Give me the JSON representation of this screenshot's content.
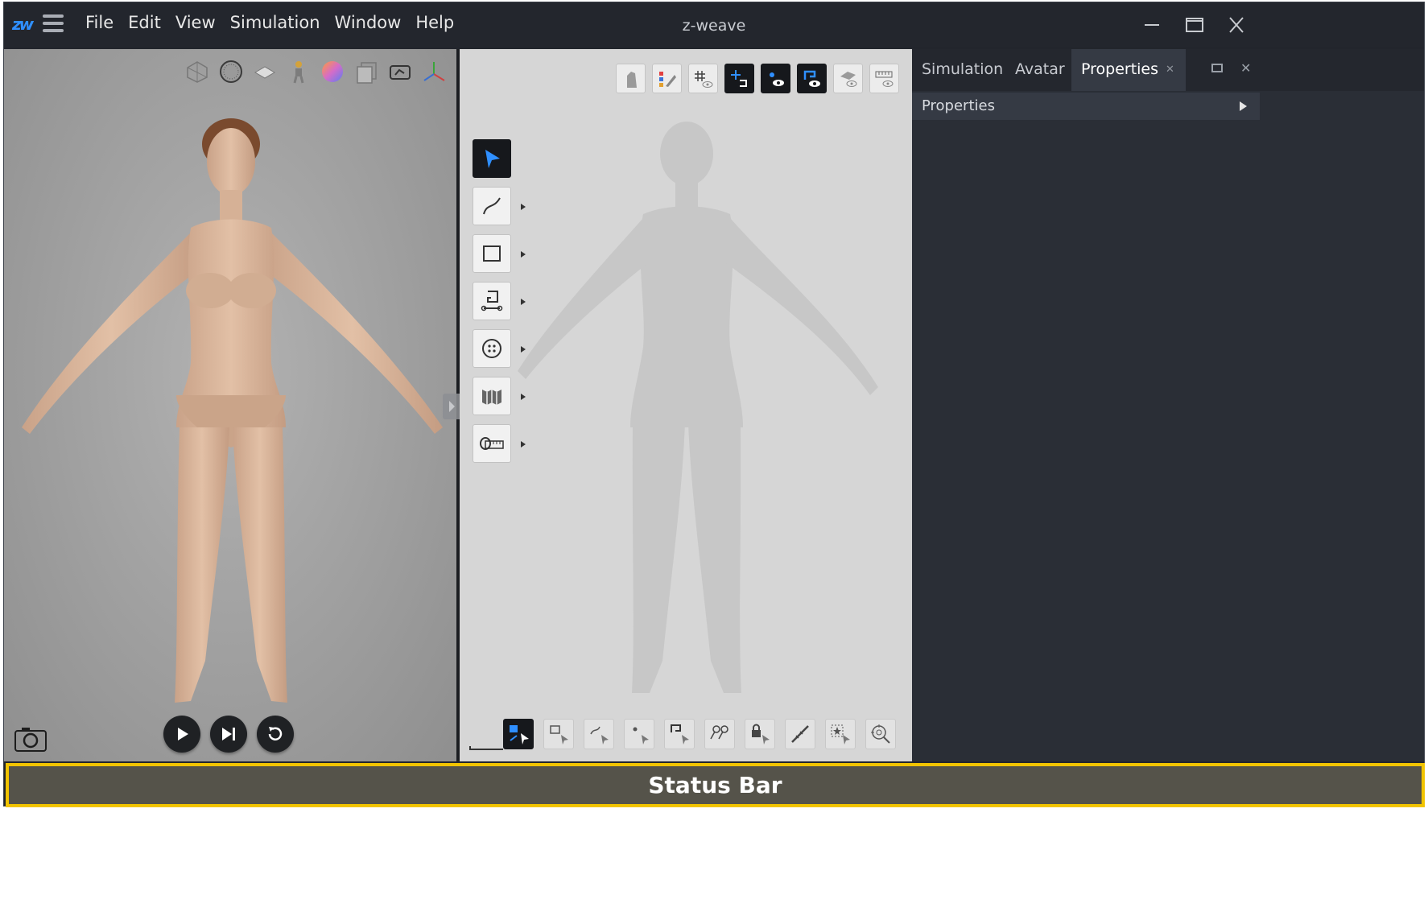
{
  "app": {
    "title": "z-weave",
    "logo_text": "zw"
  },
  "menu": [
    "File",
    "Edit",
    "View",
    "Simulation",
    "Window",
    "Help"
  ],
  "viewport3d": {
    "toolbar_icons": [
      "wireframe-icon",
      "mesh-sphere-icon",
      "plane-icon",
      "avatar-icon",
      "texture-sphere-icon",
      "layer-icon",
      "sewing-icon",
      "gizmo-icon"
    ],
    "playback": [
      "play-icon",
      "step-forward-icon",
      "reset-icon"
    ],
    "camera_icon": "camera-icon"
  },
  "viewport2d": {
    "toolbar_icons": [
      "garment-icon",
      "color-palette-icon",
      "grid-eye-icon",
      "snap-icon",
      "point-eye-icon",
      "sewing-eye-icon",
      "fabric-eye-icon",
      "ruler-eye-icon"
    ],
    "side_tools": [
      "select-arrow-icon",
      "curve-icon",
      "rectangle-icon",
      "sewing-machine-icon",
      "button-icon",
      "fold-icon",
      "tape-measure-icon"
    ],
    "bottom_tools": [
      "edit-pattern-icon",
      "select-box-icon",
      "select-curve-icon",
      "select-point-icon",
      "select-sewing-icon",
      "pin-icon",
      "lock-icon",
      "measure-icon",
      "select-star-icon",
      "search-target-icon"
    ]
  },
  "panel": {
    "tabs": [
      "Simulation",
      "Avatar",
      "Properties"
    ],
    "active_tab": "Properties",
    "section_header": "Properties"
  },
  "statusbar": {
    "label": "Status Bar"
  },
  "colors": {
    "accent": "#2f8fff",
    "status_border": "#f2c400",
    "status_bg": "#55534a"
  }
}
